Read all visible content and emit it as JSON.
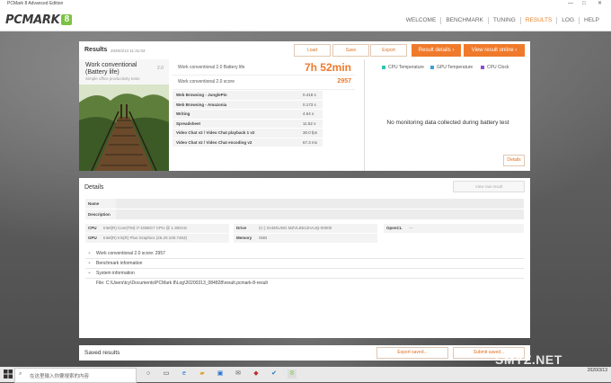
{
  "window": {
    "title": "PCMark 8 Advanced Edition",
    "min": "—",
    "max": "□",
    "close": "✕",
    "version": "2.10.901"
  },
  "logo": {
    "text": "PCMARK",
    "number": "8"
  },
  "nav": [
    "WELCOME",
    "BENCHMARK",
    "TUNING",
    "RESULTS",
    "LOG",
    "HELP"
  ],
  "nav_active": "RESULTS",
  "results": {
    "title": "Results",
    "date": "2020/3/13 11:31:04",
    "buttons": {
      "load": "Load",
      "save": "Save",
      "export": "Export",
      "details": "Result details ›",
      "online": "View result online ›"
    },
    "workload": {
      "name": "Work conventional (Battery life)",
      "version": "2.0",
      "subtitle": "Simple office productivity tests"
    },
    "battery": {
      "label": "Work conventional 2.0 Battery life",
      "value": "7h 52min"
    },
    "score": {
      "label": "Work conventional 2.0 score",
      "value": "2957"
    },
    "subtests": [
      {
        "name": "Web Browsing - JunglePin",
        "value": "0.418 s"
      },
      {
        "name": "Web Browsing - Amazonia",
        "value": "0.173 s"
      },
      {
        "name": "Writing",
        "value": "4.64 s"
      },
      {
        "name": "Spreadsheet",
        "value": "11.52 s"
      },
      {
        "name": "Video Chat v2 / Video Chat playback 1 v2",
        "value": "30.0 fps"
      },
      {
        "name": "Video Chat v2 / Video Chat encoding v2",
        "value": "67.3 ms"
      }
    ],
    "monitor": {
      "legend": [
        {
          "label": "CPU Temperature",
          "color": "#2fc4b4"
        },
        {
          "label": "GPU Temperature",
          "color": "#3aa0d8"
        },
        {
          "label": "CPU Clock",
          "color": "#8a4fd0"
        }
      ],
      "message": "No monitoring data collected during battery test",
      "details_btn": "Details"
    }
  },
  "details": {
    "title": "Details",
    "view_raw": "View raw result",
    "name_label": "Name",
    "desc_label": "Description",
    "cpu_label": "CPU",
    "cpu": "Intel(R) Core(TM) i7-1065G7 CPU @ 1.30GHz",
    "gpu_label": "GPU",
    "gpu": "Intel(R) Iris(R) Plus Graphics (26.20.100.7463)",
    "drive_label": "Drive",
    "drive": "(C:) SAMSUNG MZVLB512HAJQ-00000",
    "memory_label": "Memory",
    "memory": "0MB",
    "opencl_label": "OpenCL",
    "opencl": "---",
    "rows": [
      {
        "toggle": "+",
        "text": "Work conventional 2.0 score: 2957"
      },
      {
        "toggle": "+",
        "text": "Benchmark information"
      },
      {
        "toggle": "+",
        "text": "System information"
      }
    ],
    "file": "File: C:\\Users\\tcy\\Documents\\PCMark 8\\Log\\20200313_084828\\result.pcmark-8-result"
  },
  "saved": {
    "title": "Saved results",
    "export": "Export saved...",
    "submit": "Submit saved..."
  },
  "taskbar": {
    "search_placeholder": "在这里输入你要搜索的内容",
    "date": "2020/3/13"
  },
  "watermark": "SMYZ.NET"
}
